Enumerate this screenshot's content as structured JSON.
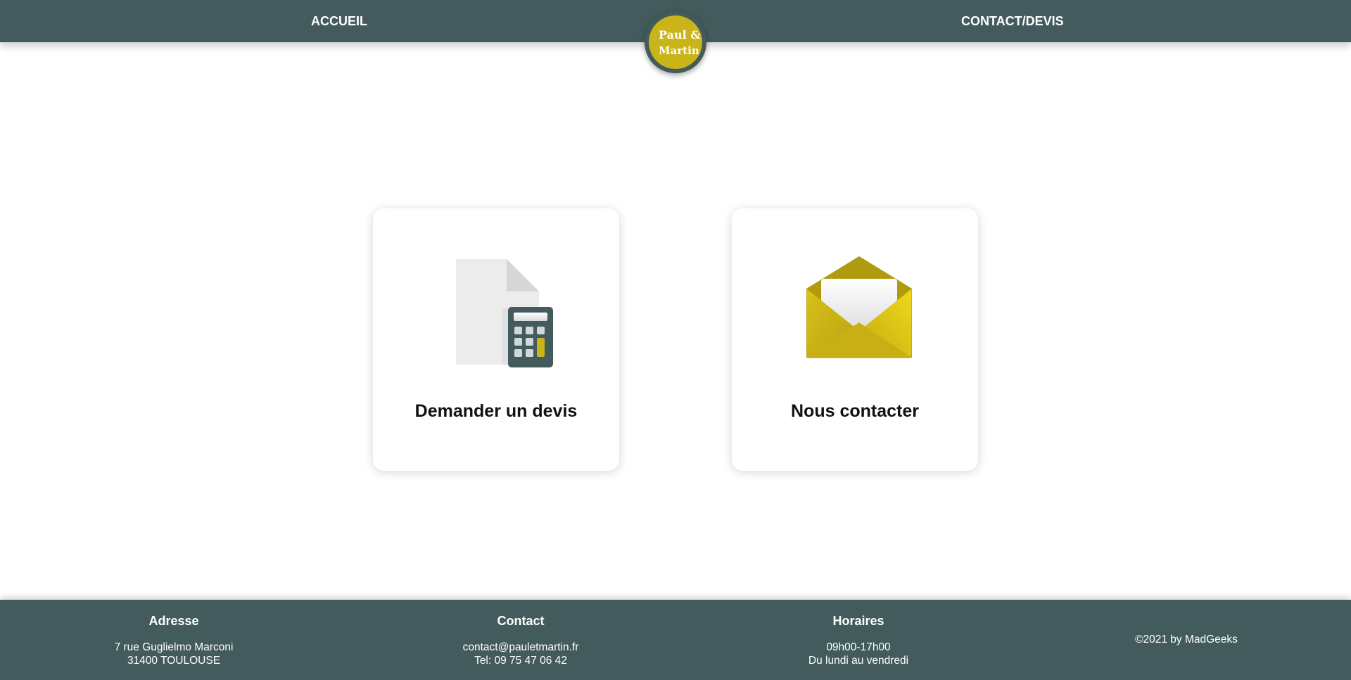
{
  "header": {
    "nav_left": "ACCUEIL",
    "nav_right": "CONTACT/DEVIS",
    "logo_line1": "Paul &",
    "logo_line2": "Martin"
  },
  "cards": [
    {
      "title": "Demander un devis",
      "icon": "calculator-document-icon"
    },
    {
      "title": "Nous contacter",
      "icon": "envelope-icon"
    }
  ],
  "footer": {
    "adresse": {
      "heading": "Adresse",
      "line1": "7 rue Guglielmo Marconi",
      "line2": "31400 TOULOUSE"
    },
    "contact": {
      "heading": "Contact",
      "line1": "contact@pauletmartin.fr",
      "line2": "Tel: 09 75 47 06 42"
    },
    "horaires": {
      "heading": "Horaires",
      "line1": "09h00-17h00",
      "line2": "Du lundi au vendredi"
    },
    "copyright": "©2021 by MadGeeks"
  },
  "colors": {
    "bar": "#435b5c",
    "accent": "#c9b41a",
    "background": "#ffffff"
  }
}
